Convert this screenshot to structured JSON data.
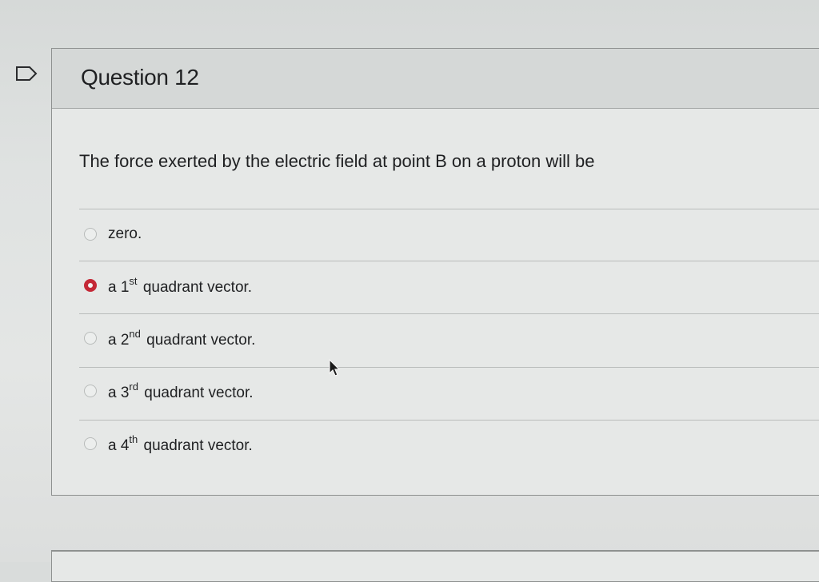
{
  "question": {
    "title": "Question 12",
    "prompt": "The force exerted by the electric field at point B on a proton will be"
  },
  "options": [
    {
      "prefix": "zero.",
      "sup": "",
      "suffix": "",
      "selected": false
    },
    {
      "prefix": "a 1",
      "sup": "st",
      "suffix": "quadrant vector.",
      "selected": true
    },
    {
      "prefix": "a 2",
      "sup": "nd",
      "suffix": "quadrant vector.",
      "selected": false
    },
    {
      "prefix": "a 3",
      "sup": "rd",
      "suffix": "quadrant vector.",
      "selected": false
    },
    {
      "prefix": "a 4",
      "sup": "th",
      "suffix": "quadrant vector.",
      "selected": false
    }
  ],
  "icons": {
    "flag": "flag-outline-icon",
    "cursor": "mouse-pointer-icon"
  },
  "colors": {
    "selected_radio": "#c42836",
    "header_bg": "#d5d8d7",
    "card_bg": "#e6e8e7"
  }
}
